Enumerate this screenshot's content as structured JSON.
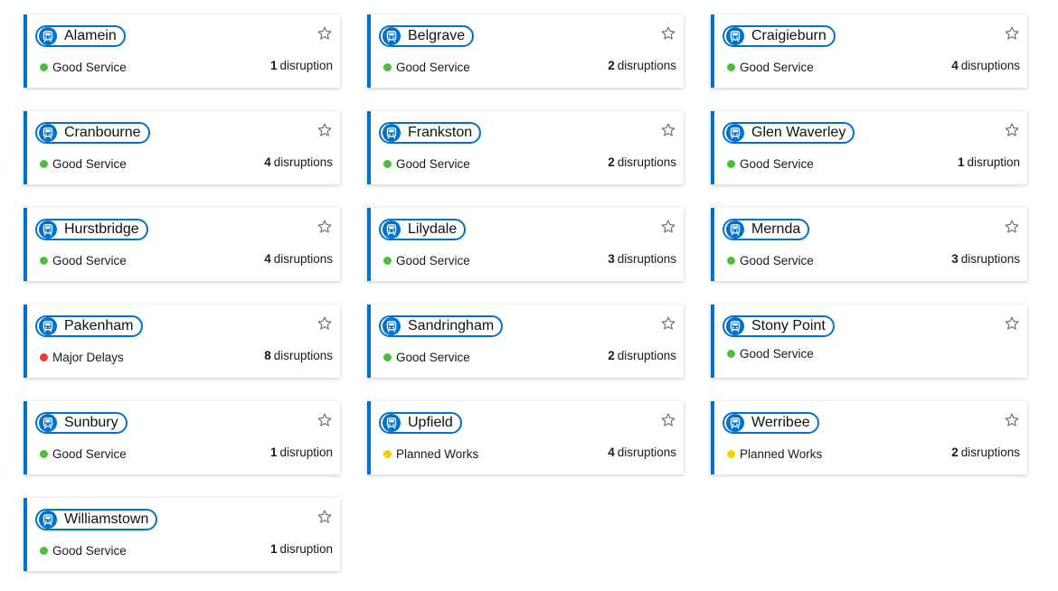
{
  "colors": {
    "accent": "#0072ce",
    "good": "#4bbf3a",
    "major": "#e4412b",
    "planned": "#f5cf00"
  },
  "icons": {
    "line": "train-icon",
    "favourite": "star-icon"
  },
  "lines": [
    {
      "name": "Alamein",
      "status": "Good Service",
      "status_type": "good",
      "count": "1",
      "unit": "disruption"
    },
    {
      "name": "Belgrave",
      "status": "Good Service",
      "status_type": "good",
      "count": "2",
      "unit": "disruptions"
    },
    {
      "name": "Craigieburn",
      "status": "Good Service",
      "status_type": "good",
      "count": "4",
      "unit": "disruptions"
    },
    {
      "name": "Cranbourne",
      "status": "Good Service",
      "status_type": "good",
      "count": "4",
      "unit": "disruptions"
    },
    {
      "name": "Frankston",
      "status": "Good Service",
      "status_type": "good",
      "count": "2",
      "unit": "disruptions"
    },
    {
      "name": "Glen Waverley",
      "status": "Good Service",
      "status_type": "good",
      "count": "1",
      "unit": "disruption"
    },
    {
      "name": "Hurstbridge",
      "status": "Good Service",
      "status_type": "good",
      "count": "4",
      "unit": "disruptions"
    },
    {
      "name": "Lilydale",
      "status": "Good Service",
      "status_type": "good",
      "count": "3",
      "unit": "disruptions"
    },
    {
      "name": "Mernda",
      "status": "Good Service",
      "status_type": "good",
      "count": "3",
      "unit": "disruptions"
    },
    {
      "name": "Pakenham",
      "status": "Major Delays",
      "status_type": "major",
      "count": "8",
      "unit": "disruptions"
    },
    {
      "name": "Sandringham",
      "status": "Good Service",
      "status_type": "good",
      "count": "2",
      "unit": "disruptions"
    },
    {
      "name": "Stony Point",
      "status": "Good Service",
      "status_type": "good",
      "count": "",
      "unit": ""
    },
    {
      "name": "Sunbury",
      "status": "Good Service",
      "status_type": "good",
      "count": "1",
      "unit": "disruption"
    },
    {
      "name": "Upfield",
      "status": "Planned Works",
      "status_type": "planned",
      "count": "4",
      "unit": "disruptions"
    },
    {
      "name": "Werribee",
      "status": "Planned Works",
      "status_type": "planned",
      "count": "2",
      "unit": "disruptions"
    },
    {
      "name": "Williamstown",
      "status": "Good Service",
      "status_type": "good",
      "count": "1",
      "unit": "disruption"
    }
  ]
}
